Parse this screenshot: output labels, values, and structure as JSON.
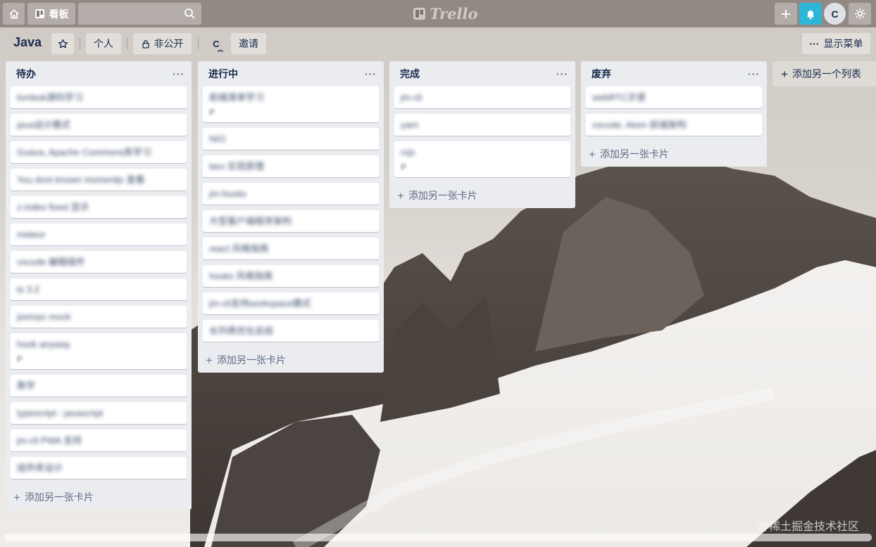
{
  "topbar": {
    "boards_label": "看板",
    "logo_text": "Trello",
    "avatar_initial": "C",
    "bell_color": "#2fb5d6"
  },
  "board": {
    "title": "Java",
    "personal_label": "个人",
    "private_label": "非公开",
    "member_initial": "C",
    "invite_label": "邀请",
    "menu_label": "显示菜单"
  },
  "lists": [
    {
      "title": "待办",
      "more": "···",
      "cards": [
        {
          "text": "lombok源码学习"
        },
        {
          "text": "java设计模式"
        },
        {
          "text": "Guava, Apache Commons库学习"
        },
        {
          "text": "You dont known momentjs 查看"
        },
        {
          "text": "z-index fixed 显示"
        },
        {
          "text": "meteor"
        },
        {
          "text": "vscode 编辑插件"
        },
        {
          "text": "ts 3.2"
        },
        {
          "text": "jsonrpc mock"
        },
        {
          "text": "hook anyway",
          "badge": "P"
        },
        {
          "text": "数学"
        },
        {
          "text": "typescript - javascript"
        },
        {
          "text": "jm-cli PWA 支持"
        },
        {
          "text": "组件库设计"
        }
      ],
      "add_label": "添加另一张卡片"
    },
    {
      "title": "进行中",
      "more": "···",
      "cards": [
        {
          "text": "前端清单学习",
          "badge": "P"
        },
        {
          "text": "NIO"
        },
        {
          "text": "taro 实现原理"
        },
        {
          "text": "jm-hooks"
        },
        {
          "text": "大型客户端程序架构"
        },
        {
          "text": "react 风格指南"
        },
        {
          "text": "hooks 风格指南"
        },
        {
          "text": "jm-cli支持workspace模式"
        },
        {
          "text": "长列表优化总结"
        }
      ],
      "add_label": "添加另一张卡片"
    },
    {
      "title": "完成",
      "more": "···",
      "cards": [
        {
          "text": "jm-cli"
        },
        {
          "text": "yarn"
        },
        {
          "text": "rxjs",
          "badge": "P"
        }
      ],
      "add_label": "添加另一张卡片"
    },
    {
      "title": "废弃",
      "more": "···",
      "cards": [
        {
          "text": "webRTC示意"
        },
        {
          "text": "vscode, Atom 前端架构"
        }
      ],
      "add_label": "添加另一张卡片"
    }
  ],
  "add_list_label": "添加另一个列表",
  "watermark": "@稀土掘金技术社区"
}
